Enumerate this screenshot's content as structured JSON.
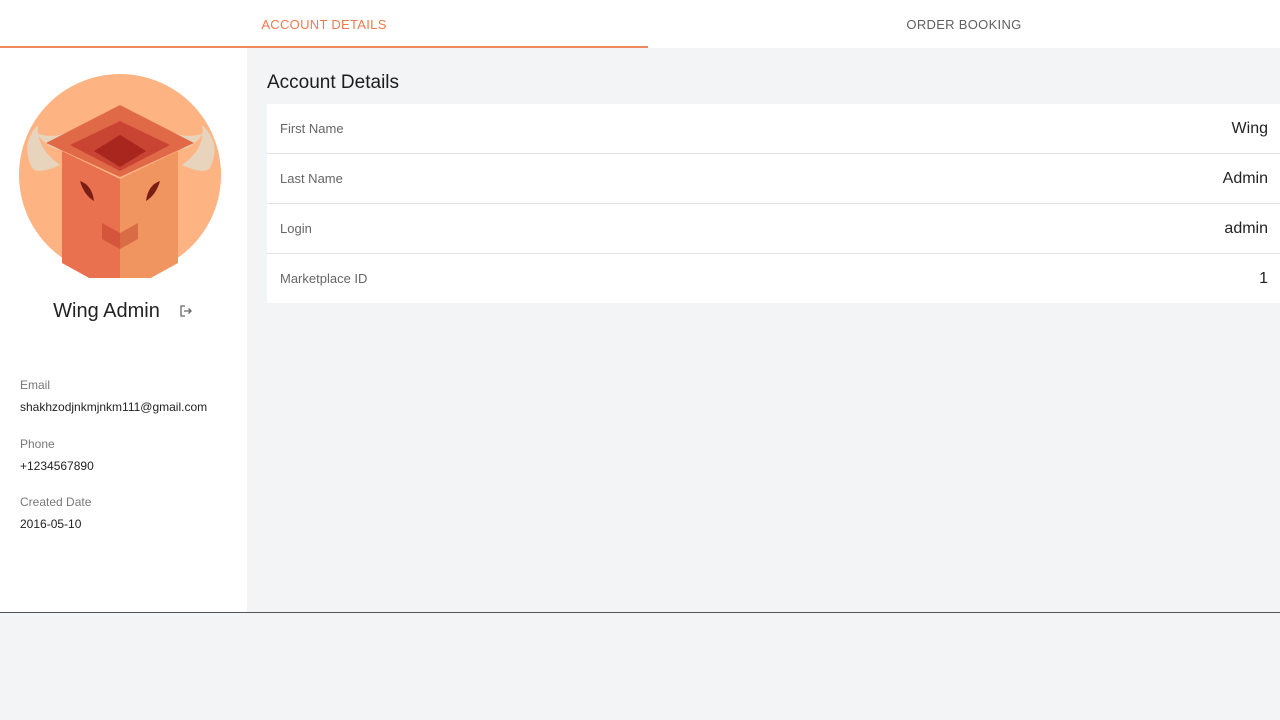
{
  "tabs": [
    {
      "label": "ACCOUNT DETAILS",
      "active": true
    },
    {
      "label": "ORDER BOOKING",
      "active": false
    }
  ],
  "profile": {
    "name": "Wing Admin",
    "avatar_icon": "bull-logo-icon",
    "logout_icon": "logout-icon",
    "email_label": "Email",
    "email": "shakhzodjnkmjnkm111@gmail.com",
    "phone_label": "Phone",
    "phone": "+1234567890",
    "created_label": "Created Date",
    "created": "2016-05-10"
  },
  "main": {
    "title": "Account Details",
    "rows": [
      {
        "key": "First Name",
        "value": "Wing"
      },
      {
        "key": "Last Name",
        "value": "Admin"
      },
      {
        "key": "Login",
        "value": "admin"
      },
      {
        "key": "Marketplace ID",
        "value": "1"
      }
    ]
  },
  "colors": {
    "accent": "#f07a4f",
    "avatar_bg": "#fdb382"
  }
}
